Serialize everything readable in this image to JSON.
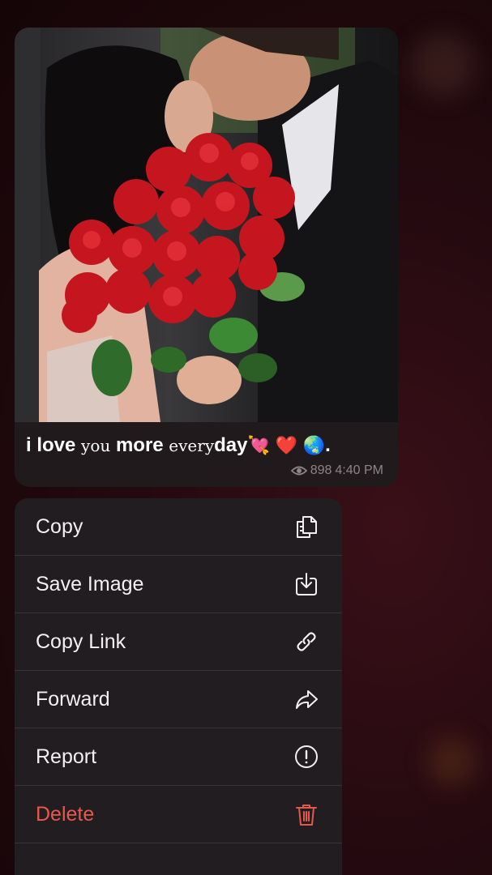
{
  "message": {
    "caption_parts": [
      "i love",
      "you",
      "more",
      "every",
      "day",
      "💘",
      "❤️",
      "🌏",
      "."
    ],
    "views": "898",
    "time": "4:40 PM",
    "photo_icon": "couple-with-roses-photo"
  },
  "menu": {
    "items": [
      {
        "label": "Copy",
        "icon": "copy-icon"
      },
      {
        "label": "Save Image",
        "icon": "download-icon"
      },
      {
        "label": "Copy Link",
        "icon": "link-icon"
      },
      {
        "label": "Forward",
        "icon": "forward-arrow-icon"
      },
      {
        "label": "Report",
        "icon": "exclamation-circle-icon"
      },
      {
        "label": "Delete",
        "icon": "trash-icon"
      }
    ],
    "danger_color": "#e8584a"
  }
}
